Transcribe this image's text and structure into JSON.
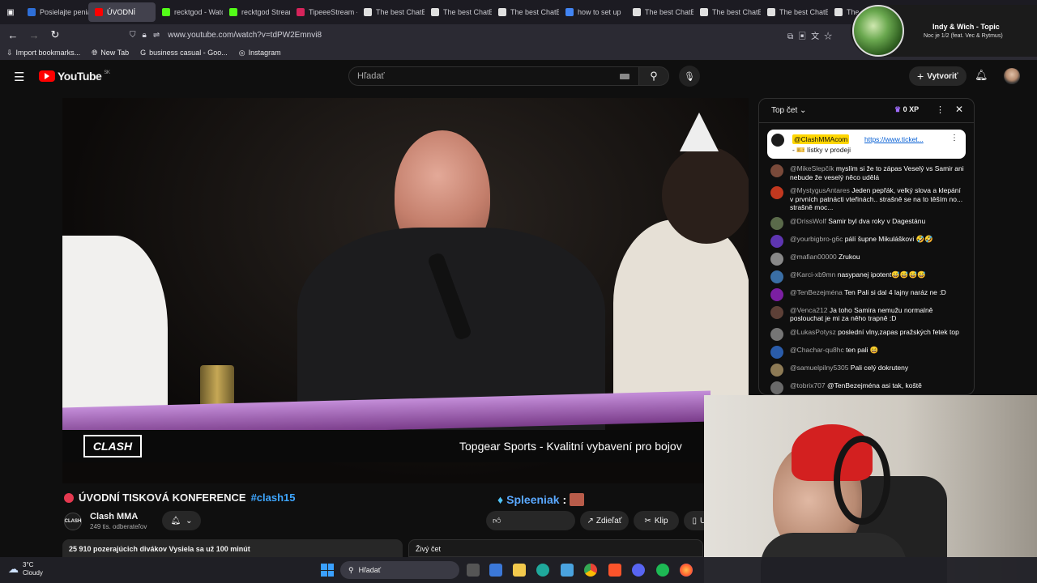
{
  "browser": {
    "tabs": [
      {
        "label": "Posielajte peniaze",
        "color": "#2e6fd8"
      },
      {
        "label": "ÚVODNÍ",
        "color": "#ff0000"
      },
      {
        "label": "recktgod - Watch",
        "color": "#53fc18"
      },
      {
        "label": "recktgod Stream",
        "color": "#53fc18"
      },
      {
        "label": "TipeeeStream -",
        "color": "#d6245b"
      },
      {
        "label": "The best ChatB",
        "color": "#e0e0e0"
      },
      {
        "label": "The best ChatB",
        "color": "#e0e0e0"
      },
      {
        "label": "The best ChatB",
        "color": "#e0e0e0"
      },
      {
        "label": "how to set up",
        "color": "#4285f4"
      },
      {
        "label": "The best ChatB",
        "color": "#e0e0e0"
      },
      {
        "label": "The best ChatB",
        "color": "#e0e0e0"
      },
      {
        "label": "The best ChatB",
        "color": "#e0e0e0"
      },
      {
        "label": "The",
        "color": "#e0e0e0"
      }
    ],
    "url": "www.youtube.com/watch?v=tdPW2Emnvi8",
    "bookmarks": [
      {
        "label": "Import bookmarks..."
      },
      {
        "label": "New Tab"
      },
      {
        "label": "business casual - Goo..."
      },
      {
        "label": "Instagram"
      }
    ]
  },
  "media": {
    "title": "Indy & Wich - Topic",
    "subtitle": "Noc je 1/2 (feat. Vec & Rytmus)"
  },
  "youtube": {
    "logo": "YouTube",
    "region": "SK",
    "search_placeholder": "Hľadať",
    "create_label": "Vytvoriť"
  },
  "video": {
    "ticker": "Topgear Sports - Kvalitní vybavení pro bojov",
    "brand": "CLASH",
    "title": "ÚVODNÍ TISKOVÁ KONFERENCE",
    "hashtag": "#clash15",
    "channel": "Clash MMA",
    "subscribers": "249 tis. odberateľov",
    "viewers": "25 910 pozerajúcich divákov  Vysiela sa už 100 minút",
    "overlay_name": "Spleeniak",
    "action_share": "Zdieľať",
    "action_clip": "Klip",
    "action_more": "Ul",
    "live_chat_label": "Živý čet"
  },
  "chat": {
    "mode": "Top čet",
    "xp": "0 XP",
    "pinned": {
      "author": "@ClashMMAcom",
      "link": "https://www.ticket...",
      "text": "- 🎫 lístky v prodeji"
    },
    "messages": [
      {
        "author": "@MikeSlepčík",
        "text": "myslím si že to zápas Veselý vs Samir ani nebude že veselý něco udělá",
        "color": "#7a4a3a"
      },
      {
        "author": "@MystygusAntares",
        "text": "Jeden pepřák, velký slova a klepání v prvních patnácti vteřinách.. strašně se na to těším no... strašně moc...",
        "color": "#c2381f"
      },
      {
        "author": "@DrissWolf",
        "text": "Samir byl dva roky v Dagestánu",
        "color": "#5a6a4a"
      },
      {
        "author": "@yourbigbro-g6c",
        "text": "pálí šupne Mikuláškovi 🤣🤣",
        "color": "#5e35b1"
      },
      {
        "author": "@mafian00000",
        "text": "Zrukou",
        "color": "#888888"
      },
      {
        "author": "@Karci-xb9mn",
        "text": "nasypanej ipotent😅😅😅😅",
        "color": "#3a6ea5"
      },
      {
        "author": "@TenBezejména",
        "text": "Ten Pali si dal 4 lajny naráz ne :D",
        "color": "#7b1fa2"
      },
      {
        "author": "@Venca212",
        "text": "Ja toho Samira nemužu normalně poslouchat je mi za něho trapně :D",
        "color": "#5d4037"
      },
      {
        "author": "@LukasPotysz",
        "text": "poslední vlny,zapas pražských fetek top",
        "color": "#757575"
      },
      {
        "author": "@Chachar-qu8hc",
        "text": "ten pali 😄",
        "color": "#2a5caa"
      },
      {
        "author": "@samuelpilny5305",
        "text": "Pali celý dokruteny",
        "color": "#8d7a55"
      },
      {
        "author": "@tobrix707",
        "text": "@TenBezejména asi tak, koště",
        "color": "#6a6a6a"
      }
    ]
  },
  "taskbar": {
    "weather_temp": "3°C",
    "weather_desc": "Cloudy",
    "search_label": "Hľadať"
  }
}
